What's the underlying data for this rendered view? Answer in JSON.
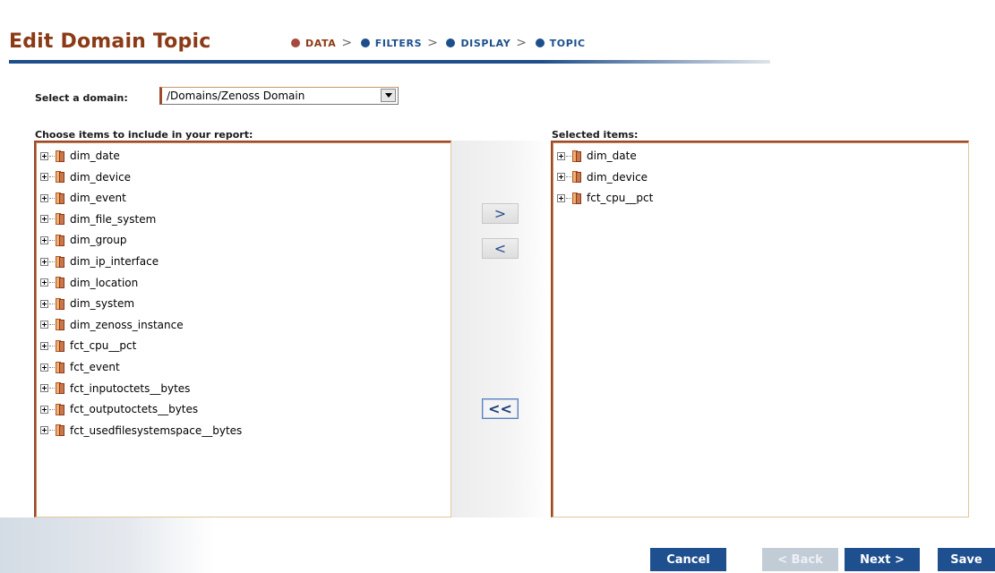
{
  "header": {
    "title": "Edit Domain Topic",
    "steps": [
      {
        "label": "DATA",
        "state": "active"
      },
      {
        "label": "FILTERS",
        "state": "inactive"
      },
      {
        "label": "DISPLAY",
        "state": "inactive"
      },
      {
        "label": "TOPIC",
        "state": "inactive"
      }
    ],
    "step_separator": ">"
  },
  "domain": {
    "label": "Select a domain:",
    "value": "/Domains/Zenoss Domain"
  },
  "available": {
    "label": "Choose items to include in your report:",
    "items": [
      "dim_date",
      "dim_device",
      "dim_event",
      "dim_file_system",
      "dim_group",
      "dim_ip_interface",
      "dim_location",
      "dim_system",
      "dim_zenoss_instance",
      "fct_cpu__pct",
      "fct_event",
      "fct_inputoctets__bytes",
      "fct_outputoctets__bytes",
      "fct_usedfilesystemspace__bytes"
    ]
  },
  "selected": {
    "label": "Selected items:",
    "items": [
      "dim_date",
      "dim_device",
      "fct_cpu__pct"
    ]
  },
  "transfer": {
    "add": ">",
    "remove": "<",
    "remove_all": "<<"
  },
  "footer": {
    "cancel": "Cancel",
    "back": "< Back",
    "next": "Next >",
    "save": "Save"
  },
  "colors": {
    "title": "#8b3a16",
    "step_active": "#a8483e",
    "step_inactive": "#1c4f8c",
    "button_primary": "#1e4f8f",
    "button_disabled": "#c2ccd6",
    "panel_border": "#9c4a2a"
  }
}
